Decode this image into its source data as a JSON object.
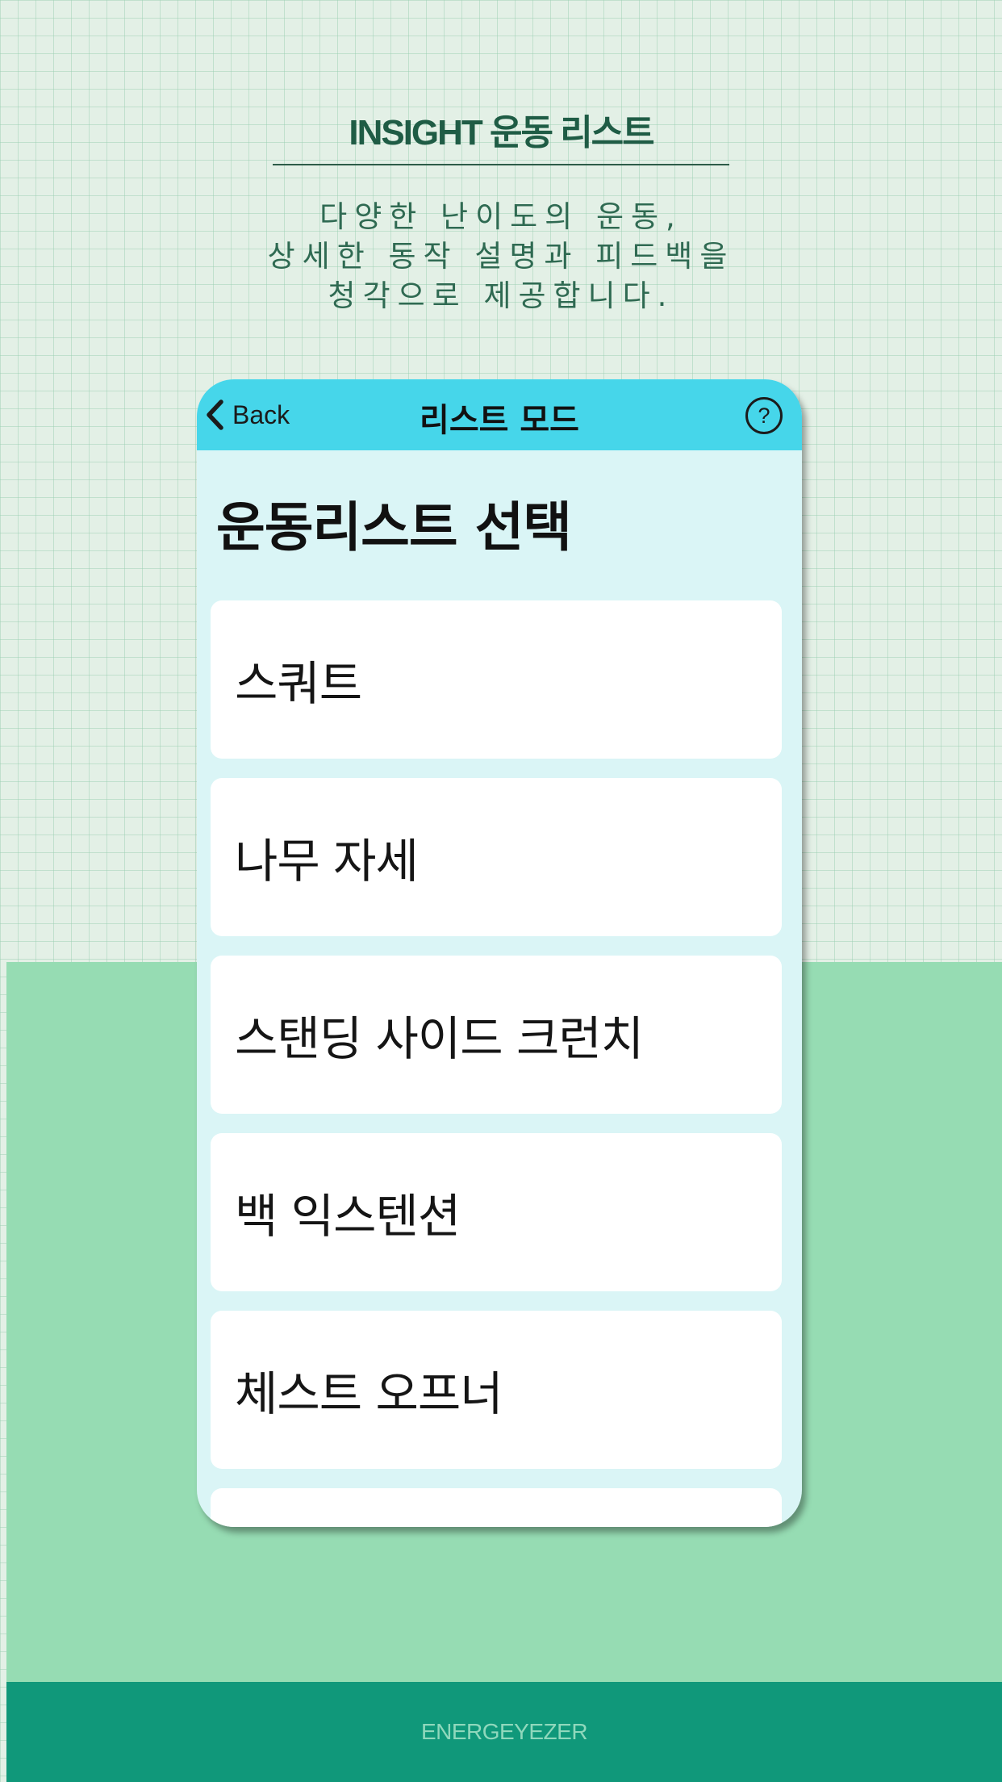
{
  "header": {
    "title": "INSIGHT 운동 리스트",
    "description_lines": [
      "다양한 난이도의 운동,",
      "상세한 동작 설명과 피드백을",
      "청각으로 제공합니다."
    ]
  },
  "app": {
    "navbar": {
      "back_label": "Back",
      "back_icon": "chevron-left-icon",
      "title": "리스트 모드",
      "help_icon": "question-circle-icon"
    },
    "page_heading": "운동리스트 선택",
    "exercises": [
      {
        "label": "스쿼트"
      },
      {
        "label": "나무 자세"
      },
      {
        "label": "스탠딩 사이드 크런치"
      },
      {
        "label": "백 익스텐션"
      },
      {
        "label": "체스트 오프너"
      },
      {
        "label": ""
      }
    ]
  },
  "footer": {
    "brand": "ENERGEYEZER"
  },
  "colors": {
    "page_background": "#e3f0e6",
    "green_band": "#96dcb3",
    "footer_background": "#10987a",
    "navbar_background": "#46d6ea",
    "app_background": "#daf5f6",
    "list_item_background": "#ffffff",
    "title_text": "#1f5c45"
  }
}
